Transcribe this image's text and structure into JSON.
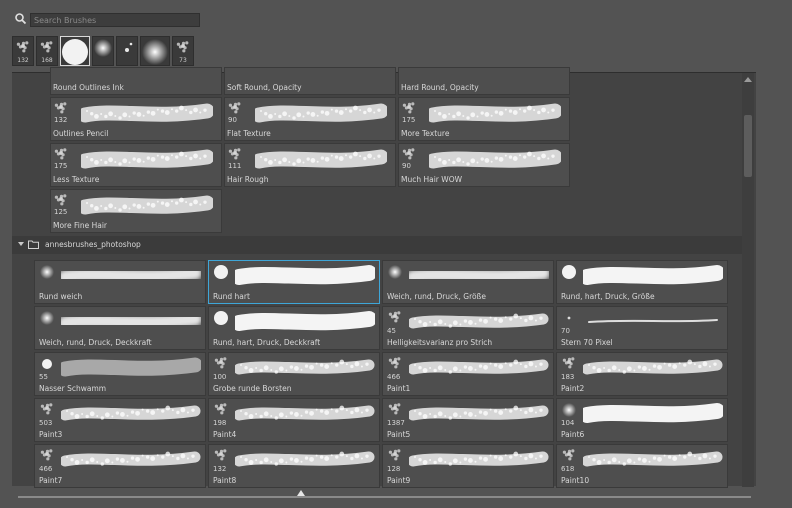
{
  "search": {
    "placeholder": "Search Brushes"
  },
  "recent": [
    {
      "num": "132",
      "kind": "dots"
    },
    {
      "num": "168",
      "kind": "dots"
    },
    {
      "num": "",
      "kind": "hard",
      "selected": true
    },
    {
      "num": "",
      "kind": "soft"
    },
    {
      "num": "",
      "kind": "star"
    },
    {
      "num": "",
      "kind": "soft2"
    },
    {
      "num": "73",
      "kind": "dots"
    }
  ],
  "top_group": [
    {
      "label": "Round Outlines Ink",
      "num": ""
    },
    {
      "label": "Soft Round, Opacity",
      "num": ""
    },
    {
      "label": "Hard Round, Opacity",
      "num": ""
    },
    {
      "label": "Outlines Pencil",
      "num": "132"
    },
    {
      "label": "Flat Texture",
      "num": "90"
    },
    {
      "label": "More Texture",
      "num": "175"
    },
    {
      "label": "Less Texture",
      "num": "175"
    },
    {
      "label": "Hair Rough",
      "num": "111"
    },
    {
      "label": "Much Hair WOW",
      "num": "90"
    },
    {
      "label": "More Fine Hair",
      "num": "125"
    }
  ],
  "group": {
    "name": "annesbrushes_photoshop"
  },
  "brushes": [
    {
      "label": "Rund weich",
      "num": "",
      "tip": "soft",
      "stroke": "soft"
    },
    {
      "label": "Rund hart",
      "num": "",
      "tip": "hard",
      "stroke": "hard",
      "selected": true
    },
    {
      "label": "Weich, rund, Druck, Größe",
      "num": "",
      "tip": "soft",
      "stroke": "soft"
    },
    {
      "label": "Rund, hart, Druck, Größe",
      "num": "",
      "tip": "hard",
      "stroke": "hard"
    },
    {
      "label": "Weich, rund, Druck, Deckkraft",
      "num": "",
      "tip": "soft",
      "stroke": "soft"
    },
    {
      "label": "Rund, hart, Druck, Deckkraft",
      "num": "",
      "tip": "hard",
      "stroke": "hard"
    },
    {
      "label": "Helligkeitsvarianz pro Strich",
      "num": "45",
      "tip": "dots",
      "stroke": "rough"
    },
    {
      "label": "Stern 70 Pixel",
      "num": "70",
      "tip": "tiny",
      "stroke": "thin"
    },
    {
      "label": "Nasser Schwamm",
      "num": "55",
      "tip": "hardsmall",
      "stroke": "sponge"
    },
    {
      "label": "Grobe runde Borsten",
      "num": "100",
      "tip": "dots",
      "stroke": "rough"
    },
    {
      "label": "Paint1",
      "num": "466",
      "tip": "dots",
      "stroke": "rough"
    },
    {
      "label": "Paint2",
      "num": "183",
      "tip": "dots",
      "stroke": "rough"
    },
    {
      "label": "Paint3",
      "num": "503",
      "tip": "dots",
      "stroke": "rough"
    },
    {
      "label": "Paint4",
      "num": "198",
      "tip": "dots",
      "stroke": "rough"
    },
    {
      "label": "Paint5",
      "num": "1387",
      "tip": "dots",
      "stroke": "rough"
    },
    {
      "label": "Paint6",
      "num": "104",
      "tip": "soft",
      "stroke": "hard"
    },
    {
      "label": "Paint7",
      "num": "466",
      "tip": "dots",
      "stroke": "rough"
    },
    {
      "label": "Paint8",
      "num": "132",
      "tip": "dots",
      "stroke": "rough"
    },
    {
      "label": "Paint9",
      "num": "128",
      "tip": "dots",
      "stroke": "rough"
    },
    {
      "label": "Paint10",
      "num": "618",
      "tip": "dots",
      "stroke": "rough"
    }
  ]
}
